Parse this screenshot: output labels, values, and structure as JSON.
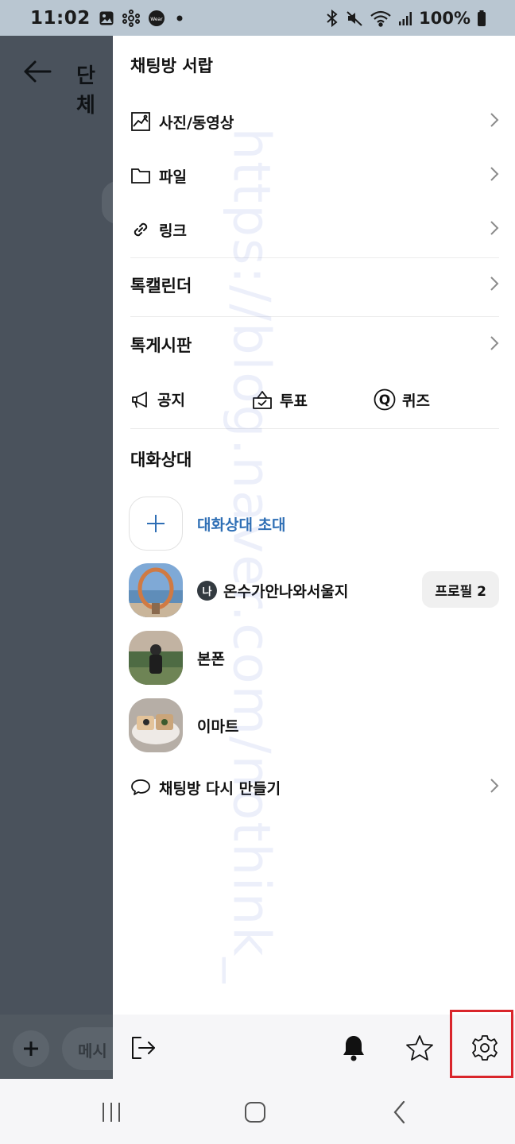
{
  "status_bar": {
    "time": "11:02",
    "battery": "100%",
    "left_icons": [
      "gallery-icon",
      "network-icon",
      "wear-icon",
      "dot-icon"
    ],
    "right_icons": [
      "bluetooth-icon",
      "mute-icon",
      "wifi-icon",
      "signal-icon",
      "battery-icon"
    ],
    "wear_label": "Wear"
  },
  "chat": {
    "title": "단체",
    "input_placeholder": "메시"
  },
  "drawer": {
    "drawer_title": "채팅방 서랍",
    "menu": [
      {
        "label": "사진/동영상",
        "icon": "image-icon"
      },
      {
        "label": "파일",
        "icon": "folder-icon"
      },
      {
        "label": "링크",
        "icon": "link-icon"
      },
      {
        "label": "톡캘린더"
      },
      {
        "label": "톡게시판"
      }
    ],
    "quick": [
      {
        "label": "공지",
        "icon": "megaphone-icon"
      },
      {
        "label": "투표",
        "icon": "vote-box-icon"
      },
      {
        "label": "퀴즈",
        "icon": "quiz-icon",
        "glyph": "Q"
      }
    ],
    "participants_title": "대화상대",
    "invite_label": "대화상대 초대",
    "members": [
      {
        "name": "온수가안나와서울지",
        "me_badge": "나",
        "profile_button": "프로필 2"
      },
      {
        "name": "본폰"
      },
      {
        "name": "이마트"
      }
    ],
    "recreate_label": "채팅방 다시 만들기"
  },
  "toolbar_icons": [
    "exit-icon",
    "bell-icon",
    "star-icon",
    "gear-icon"
  ],
  "watermark": "https://blog.naver.com/nothink_",
  "colors": {
    "status_bar_bg": "#b9c6d1",
    "dim_overlay": "#4a525c",
    "invite_text": "#2f6fb5",
    "highlight": "#d9252b"
  }
}
